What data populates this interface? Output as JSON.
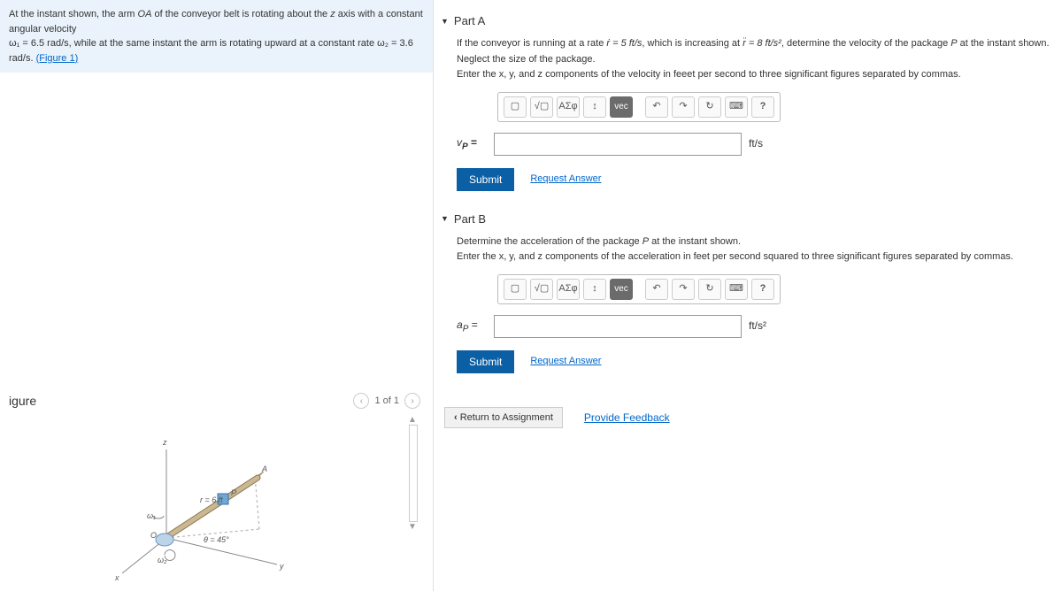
{
  "prompt": {
    "line1_a": "At the instant shown, the arm ",
    "line1_oa": "OA",
    "line1_b": " of the conveyor belt is rotating about the ",
    "line1_z": "z",
    "line1_c": " axis with a constant angular velocity",
    "line2_a": "ω₁ = 6.5 rad/s, while at the same instant the arm is rotating upward at a constant rate ω₂ = 3.6 rad/s. ",
    "figure_link": "(Figure 1)"
  },
  "figure": {
    "title": "igure",
    "page": "1 of 1",
    "r_label": "r = 6 ft",
    "theta_label": "θ = 45°",
    "A": "A",
    "P": "P",
    "O": "O",
    "w1": "ω₁",
    "w2": "ω₂",
    "x": "x",
    "y": "y",
    "z": "z"
  },
  "partA": {
    "title": "Part A",
    "text1_a": "If the conveyor is running at a rate ",
    "text1_rd": "ṙ = 5 ft/s",
    "text1_b": ", which is increasing at ",
    "text1_rdd": "r̈ = 8 ft/s²",
    "text1_c": ", determine the velocity of the package ",
    "text1_P": "P",
    "text1_d": " at the instant shown. Neglect the size of the package.",
    "text2": "Enter the x, y, and z components of the velocity in feeet per second to three significant figures separated by commas.",
    "var": "vP =",
    "unit": "ft/s",
    "submit": "Submit",
    "request": "Request Answer"
  },
  "partB": {
    "title": "Part B",
    "text1_a": "Determine the acceleration of the package ",
    "text1_P": "P",
    "text1_b": " at the instant shown.",
    "text2": "Enter the x, y, and z components of the acceleration in feet per second squared to three significant figures separated by commas.",
    "var": "aP =",
    "unit": "ft/s²",
    "submit": "Submit",
    "request": "Request Answer"
  },
  "tools": {
    "t1": "▢",
    "t2": "√▢",
    "t3": "ΑΣφ",
    "t4": "↕",
    "vec": "vec",
    "undo": "↶",
    "redo": "↷",
    "reset": "↻",
    "kb": "⌨",
    "help": "?"
  },
  "footer": {
    "return": "Return to Assignment",
    "feedback": "Provide Feedback"
  }
}
